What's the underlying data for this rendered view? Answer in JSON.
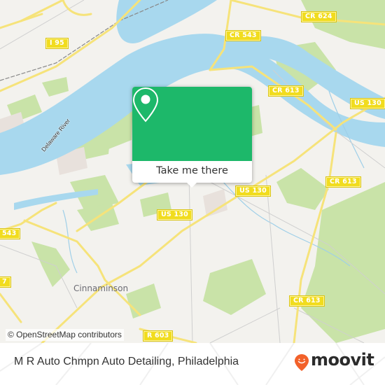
{
  "map": {
    "road_shields": [
      {
        "id": "i95",
        "label": "I 95"
      },
      {
        "id": "cr543-top",
        "label": "CR 543"
      },
      {
        "id": "cr624",
        "label": "CR 624"
      },
      {
        "id": "cr613-top",
        "label": "CR 613"
      },
      {
        "id": "us130-right",
        "label": "US 130"
      },
      {
        "id": "cr613-right",
        "label": "CR 613"
      },
      {
        "id": "us130-center",
        "label": "US 130"
      },
      {
        "id": "us130-left",
        "label": "US 130"
      },
      {
        "id": "cr543-left",
        "label": "543"
      },
      {
        "id": "cr-left-partial",
        "label": "7"
      },
      {
        "id": "cr613-bottom",
        "label": "CR 613"
      },
      {
        "id": "cr603",
        "label": "R 603"
      }
    ],
    "water_labels": [
      {
        "label": "Delaware River"
      }
    ],
    "place_labels": [
      {
        "label": "Cinnaminson"
      }
    ],
    "colors": {
      "land": "#f3f2ee",
      "water": "#a8d8ee",
      "park": "#c9e3a8",
      "road_major": "#f6e37a",
      "road_minor": "#cfcfcf"
    }
  },
  "popup": {
    "icon": "map-pin-icon",
    "cta_label": "Take me there",
    "color": "#1db86a"
  },
  "attribution": {
    "text": "© OpenStreetMap contributors"
  },
  "footer": {
    "place_title": "M R Auto Chmpn Auto Detailing, Philadelphia",
    "brand": {
      "name": "moovit",
      "icon": "moovit-logo-icon",
      "color": "#f2612a"
    }
  }
}
